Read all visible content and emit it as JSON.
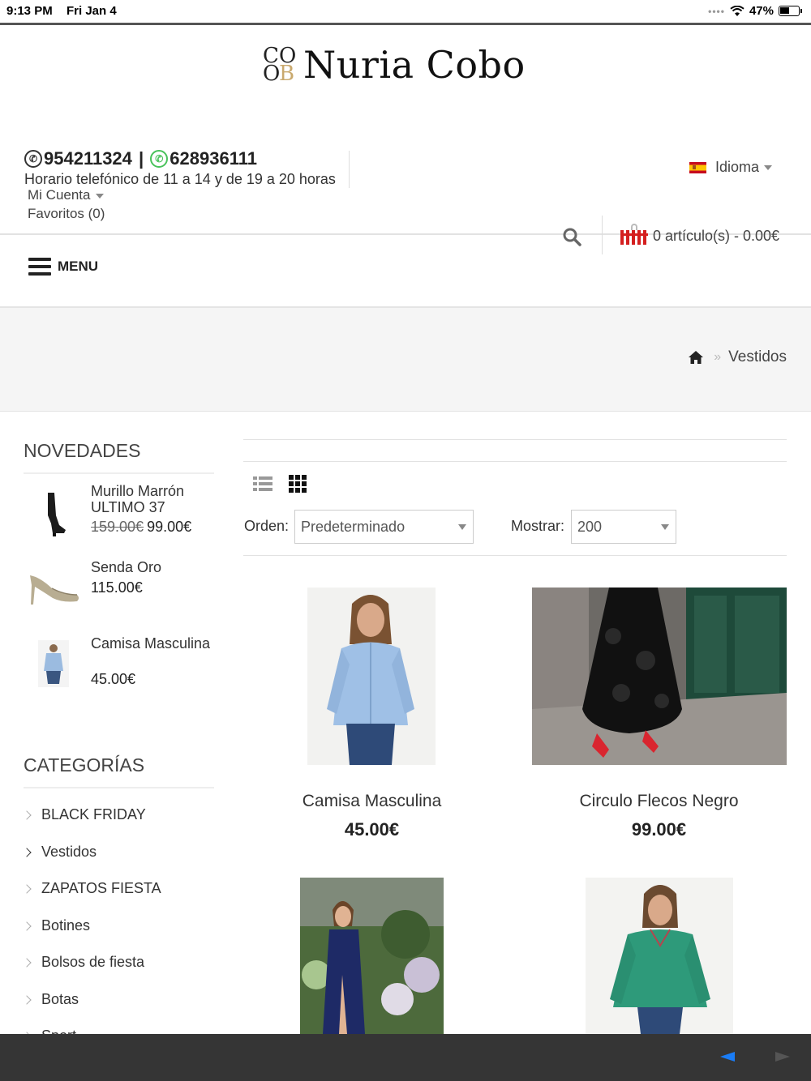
{
  "status_bar": {
    "time": "9:13 PM",
    "date": "Fri Jan 4",
    "battery": "47%"
  },
  "header": {
    "brand_monogram": "CO OB",
    "brand_name": "Nuria Cobo",
    "phone": "954211324",
    "separator": " | ",
    "whatsapp": "628936111",
    "hours": "Horario telefónico de 11 a 14 y de 19 a 20 horas",
    "account_label": "Mi Cuenta",
    "favorites_label": "Favoritos (0)",
    "language_label": "Idioma",
    "cart_label": "0 artículo(s) - 0.00€",
    "menu_label": "MENU"
  },
  "breadcrumb": {
    "current": "Vestidos",
    "separator": "»"
  },
  "sidebar": {
    "novedades_title": "NOVEDADES",
    "novedades": [
      {
        "name": "Murillo Marrón ULTIMO 37",
        "old_price": "159.00€",
        "price": "99.00€"
      },
      {
        "name": "Senda Oro",
        "price": "115.00€"
      },
      {
        "name": "Camisa Masculina",
        "price": "45.00€"
      }
    ],
    "categories_title": "CATEGORÍAS",
    "categories": [
      "BLACK FRIDAY",
      "Vestidos",
      "ZAPATOS FIESTA",
      "Botines",
      "Bolsos de fiesta",
      "Botas",
      "Sport"
    ]
  },
  "toolbar": {
    "order_label": "Orden:",
    "order_value": "Predeterminado",
    "show_label": "Mostrar:",
    "show_value": "200"
  },
  "products": [
    {
      "name": "Camisa Masculina",
      "price": "45.00€"
    },
    {
      "name": "Circulo Flecos Negro",
      "price": "99.00€"
    },
    {
      "name": "",
      "price": ""
    },
    {
      "name": "",
      "price": ""
    }
  ],
  "colors": {
    "accent_red": "#d41f1f",
    "whatsapp_green": "#49c25b",
    "gold": "#c9a96e",
    "browser_blue": "#1a7cf5"
  }
}
